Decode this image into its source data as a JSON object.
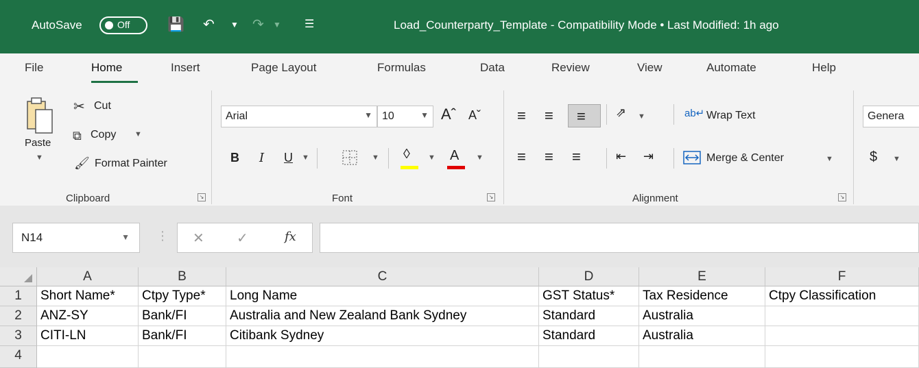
{
  "titlebar": {
    "autosave_label": "AutoSave",
    "autosave_state": "Off",
    "doc_title": "Load_Counterparty_Template  -  Compatibility Mode • Last Modified: 1h ago"
  },
  "menu_tabs": [
    "File",
    "Home",
    "Insert",
    "Page Layout",
    "Formulas",
    "Data",
    "Review",
    "View",
    "Automate",
    "Help"
  ],
  "active_tab": "Home",
  "ribbon": {
    "clipboard": {
      "paste": "Paste",
      "cut": "Cut",
      "copy": "Copy",
      "format_painter": "Format Painter",
      "group_label": "Clipboard"
    },
    "font": {
      "font_name": "Arial",
      "font_size": "10",
      "bold": "B",
      "italic": "I",
      "underline": "U",
      "font_color_glyph": "A",
      "group_label": "Font"
    },
    "alignment": {
      "wrap_text": "Wrap Text",
      "merge_center": "Merge & Center",
      "group_label": "Alignment"
    },
    "number": {
      "format": "Genera",
      "currency": "$"
    }
  },
  "formula_bar": {
    "name_box": "N14",
    "fx_label": "fx",
    "value": ""
  },
  "sheet": {
    "columns": [
      "A",
      "B",
      "C",
      "D",
      "E",
      "F"
    ],
    "rows": [
      {
        "num": "1",
        "cells": [
          "Short Name*",
          "Ctpy Type*",
          "Long Name",
          "GST Status*",
          "Tax Residence",
          "Ctpy Classification"
        ]
      },
      {
        "num": "2",
        "cells": [
          "ANZ-SY",
          "Bank/FI",
          "Australia and New Zealand Bank Sydney",
          "Standard",
          "Australia",
          ""
        ]
      },
      {
        "num": "3",
        "cells": [
          "CITI-LN",
          "Bank/FI",
          "Citibank Sydney",
          "Standard",
          "Australia",
          ""
        ]
      },
      {
        "num": "4",
        "cells": [
          "",
          "",
          "",
          "",
          "",
          ""
        ]
      }
    ]
  },
  "colors": {
    "title_bar": "#1e7145",
    "ribbon_bg": "#f3f3f3",
    "header_bg": "#e9e9e9",
    "fill_color": "#ffff00",
    "font_color": "#e00000"
  }
}
